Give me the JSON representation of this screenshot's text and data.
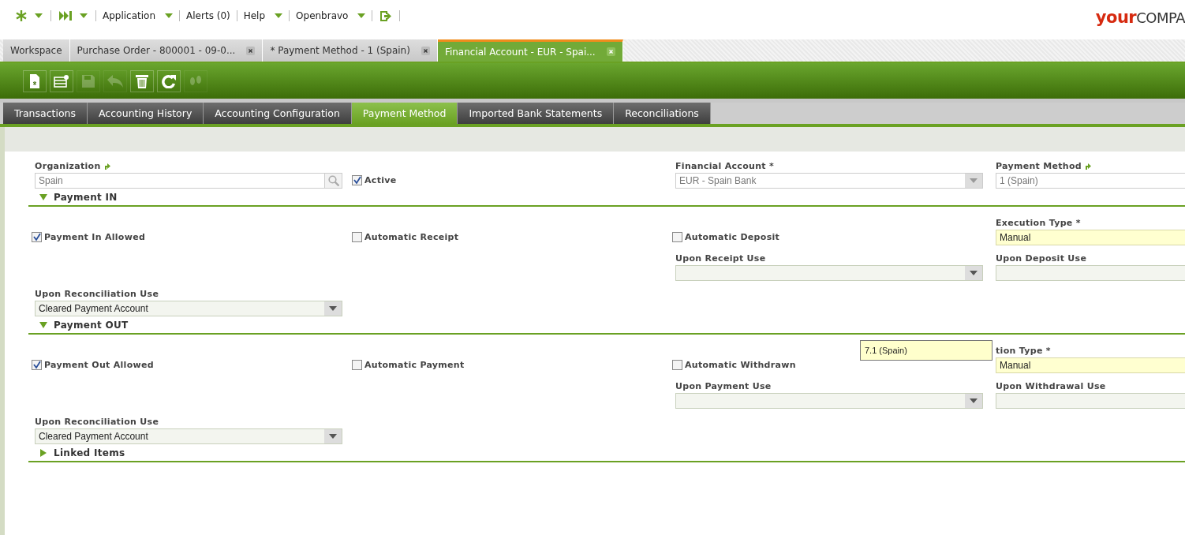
{
  "top_menu": {
    "items": [
      {
        "label": "Application",
        "dropdown": true
      },
      {
        "label": "Alerts (0)",
        "dropdown": false
      },
      {
        "label": "Help",
        "dropdown": true
      },
      {
        "label": "Openbravo",
        "dropdown": true
      }
    ]
  },
  "logo": {
    "part_1": "your",
    "part_2": "COMPA"
  },
  "window_tabs": [
    {
      "label": "Workspace",
      "closable": false,
      "selected": false
    },
    {
      "label": "Purchase Order - 800001 - 09-0...",
      "closable": true,
      "selected": false
    },
    {
      "label": "* Payment Method - 1 (Spain)",
      "closable": true,
      "selected": false
    },
    {
      "label": "Financial Account - EUR - Spai...",
      "closable": true,
      "selected": true
    }
  ],
  "toolbar": {
    "buttons": [
      {
        "kind": "new",
        "disabled": false
      },
      {
        "kind": "new-grid",
        "disabled": false
      },
      {
        "kind": "save",
        "disabled": true
      },
      {
        "kind": "undo",
        "disabled": true
      },
      {
        "kind": "delete",
        "disabled": false
      },
      {
        "kind": "refresh",
        "disabled": false
      },
      {
        "kind": "audit",
        "disabled": true
      }
    ]
  },
  "subtabs": [
    {
      "label": "Transactions",
      "selected": false
    },
    {
      "label": "Accounting History",
      "selected": false
    },
    {
      "label": "Accounting Configuration",
      "selected": false
    },
    {
      "label": "Payment Method",
      "selected": true
    },
    {
      "label": "Imported Bank Statements",
      "selected": false
    },
    {
      "label": "Reconciliations",
      "selected": false
    }
  ],
  "header_rows": [
    [
      {
        "kind": "search",
        "label": "Organization",
        "linked": true,
        "value": "Spain",
        "readonly": true
      },
      {
        "kind": "checkbox",
        "label": "Active",
        "checked": true
      },
      {
        "kind": "select",
        "label": "Financial Account *",
        "linked": false,
        "value": "EUR - Spain Bank",
        "readonly": true
      },
      {
        "kind": "text",
        "label": "Payment Method",
        "linked": true,
        "value": "1 (Spain)",
        "readonly": true,
        "mandatory": false
      }
    ]
  ],
  "sections": [
    {
      "title": "Payment IN",
      "expanded": true,
      "rows": [
        [
          {
            "kind": "checkbox",
            "label": "Payment In Allowed",
            "checked": true
          },
          {
            "kind": "checkbox",
            "label": "Automatic Receipt",
            "checked": false
          },
          {
            "kind": "checkbox",
            "label": "Automatic Deposit",
            "checked": false
          },
          {
            "kind": "text",
            "label": "Execution Type *",
            "linked": false,
            "value": "Manual",
            "readonly": false,
            "mandatory": true
          }
        ],
        [
          {
            "kind": "blank"
          },
          {
            "kind": "blank"
          },
          {
            "kind": "select",
            "label": "Upon Receipt Use",
            "linked": false,
            "readonly": false
          },
          {
            "kind": "cut-select",
            "label": "Upon Deposit Use",
            "linked": false,
            "readonly": false
          }
        ],
        [
          {
            "kind": "select",
            "label": "Upon Reconciliation Use",
            "linked": false,
            "value": "Cleared Payment Account",
            "readonly": false
          }
        ]
      ]
    },
    {
      "title": "Payment OUT",
      "expanded": true,
      "rows": [
        [
          {
            "kind": "checkbox",
            "label": "Payment Out Allowed",
            "checked": true
          },
          {
            "kind": "checkbox",
            "label": "Automatic Payment",
            "checked": false
          },
          {
            "kind": "checkbox",
            "label": "Automatic Withdrawn",
            "checked": false
          },
          {
            "kind": "text",
            "label": "tion Type *",
            "linked": false,
            "value": "Manual",
            "readonly": false,
            "mandatory": true
          }
        ],
        [
          {
            "kind": "blank"
          },
          {
            "kind": "blank"
          },
          {
            "kind": "select",
            "label": "Upon Payment Use",
            "linked": false,
            "readonly": false
          },
          {
            "kind": "cut-select",
            "label": "Upon Withdrawal Use",
            "linked": false,
            "readonly": false
          }
        ],
        [
          {
            "kind": "select",
            "label": "Upon Reconciliation Use",
            "linked": false,
            "value": "Cleared Payment Account",
            "readonly": false
          }
        ]
      ]
    },
    {
      "title": "Linked Items",
      "expanded": false
    }
  ],
  "tooltip": {
    "text": "7.1 (Spain)"
  }
}
